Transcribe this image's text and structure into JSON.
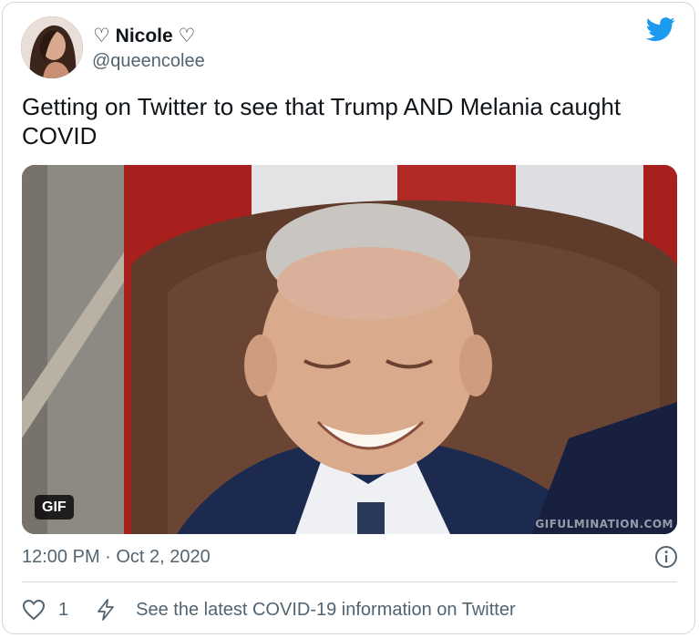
{
  "tweet": {
    "author": {
      "display_name": "♡ Nicole ♡",
      "handle": "@queencolee",
      "avatar": "profile-photo"
    },
    "text": "Getting on Twitter to see that Trump AND Melania caught COVID",
    "media": {
      "badge": "GIF",
      "watermark": "GIFULMINATION.COM"
    },
    "timestamp": "12:00 PM · Oct 2, 2020",
    "actions": {
      "like_count": "1",
      "covid_info_label": "See the latest COVID-19 information on Twitter"
    }
  },
  "icons": {
    "brand": "twitter-bird-icon",
    "info": "info-icon",
    "like": "heart-icon",
    "covid": "lightning-icon"
  },
  "colors": {
    "twitter_blue": "#1d9bf0",
    "secondary_text": "#536471",
    "border": "#cfd9de"
  }
}
